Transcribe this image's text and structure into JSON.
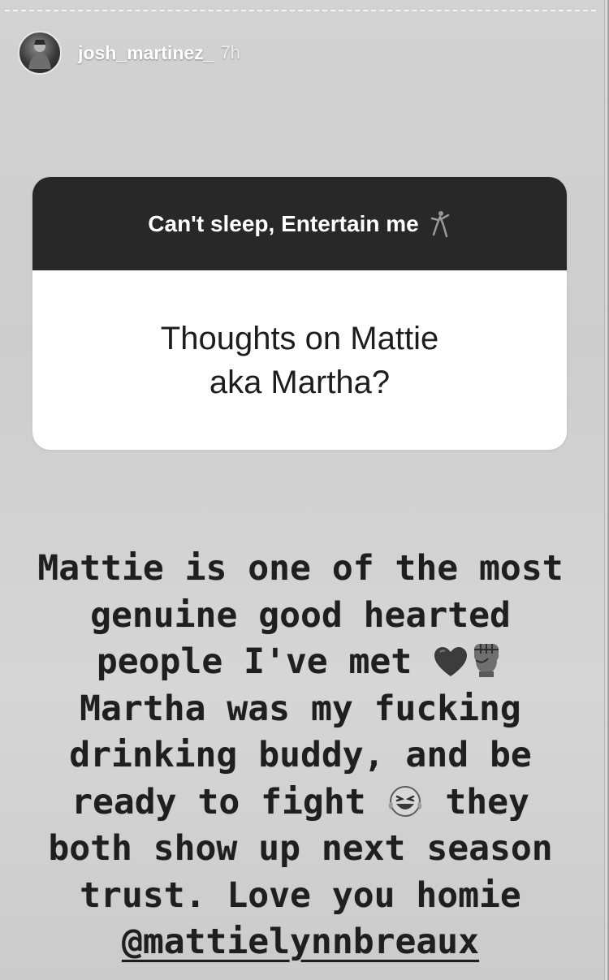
{
  "story": {
    "username": "josh_martinez_",
    "time_ago": "7h"
  },
  "question_sticker": {
    "prompt": "Can't sleep, Entertain me",
    "prompt_emoji": "dancer-icon",
    "question_line1": "Thoughts on Mattie",
    "question_line2": "aka Martha?"
  },
  "reply": {
    "line1": "Mattie is one of the most",
    "line2": "genuine good hearted",
    "line3": "people I've met",
    "line3_emojis": [
      "heart-icon",
      "raised-fist-icon"
    ],
    "line4": "Martha was my fucking",
    "line5": "drinking buddy, and be",
    "line6_before": "ready to fight",
    "line6_emoji": "laughing-face-icon",
    "line6_after": "they",
    "line7": "both show up next season",
    "line8": "trust.   Love you homie",
    "mention": "@mattielynnbreaux"
  },
  "colors": {
    "background": "#cfcfcf",
    "sticker_header": "#282828",
    "text": "#1f1f1f"
  }
}
